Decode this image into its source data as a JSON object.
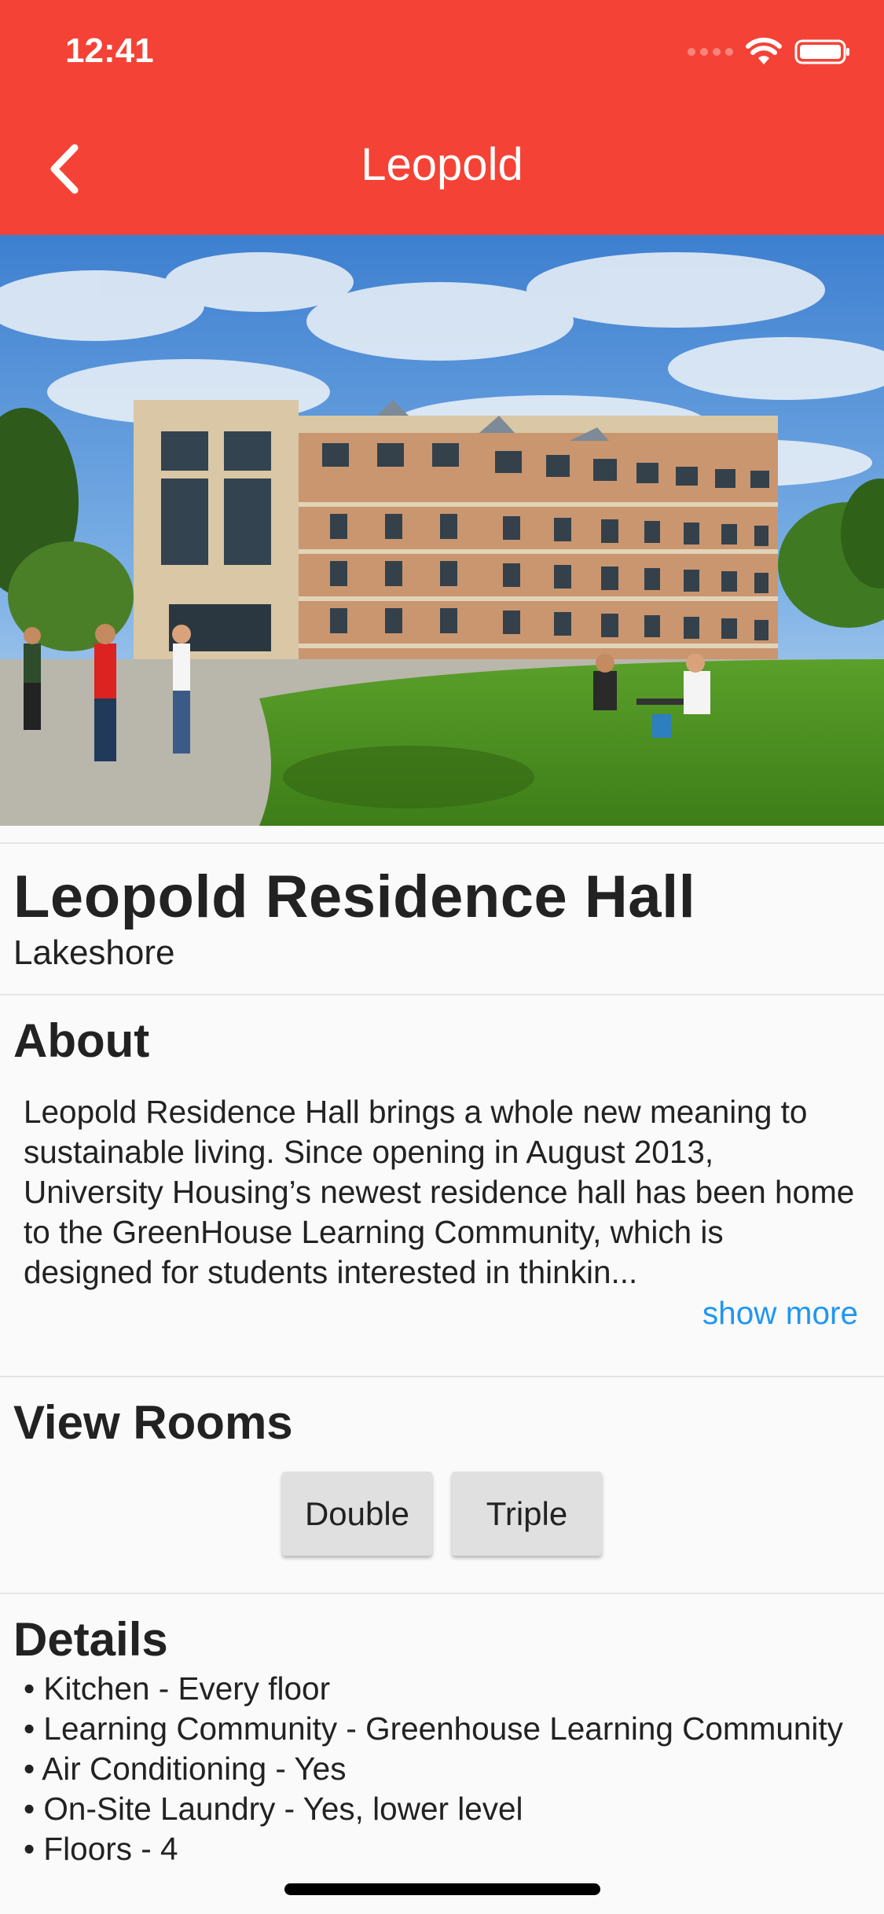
{
  "status_bar": {
    "time": "12:41",
    "signal_icon": "signal-dots-icon",
    "wifi_icon": "wifi-icon",
    "battery_icon": "battery-icon"
  },
  "app_bar": {
    "title": "Leopold",
    "back_icon": "chevron-left-icon",
    "background": "#f44336"
  },
  "hall": {
    "name": "Leopold Residence Hall",
    "area": "Lakeshore"
  },
  "about": {
    "heading": "About",
    "text": "Leopold Residence Hall brings a whole new meaning to sustainable living. Since opening in August 2013, University Housing’s newest residence hall has been home to the GreenHouse Learning Community, which is designed for students interested in thinkin...",
    "show_more": "show more",
    "link_color": "#2196f3"
  },
  "rooms": {
    "heading": "View Rooms",
    "buttons": [
      "Double",
      "Triple"
    ]
  },
  "details": {
    "heading": "Details",
    "items": [
      "• Kitchen - Every floor",
      "• Learning Community - Greenhouse Learning Community",
      "• Air Conditioning - Yes",
      "• On-Site Laundry - Yes, lower level",
      "• Floors - 4"
    ]
  }
}
